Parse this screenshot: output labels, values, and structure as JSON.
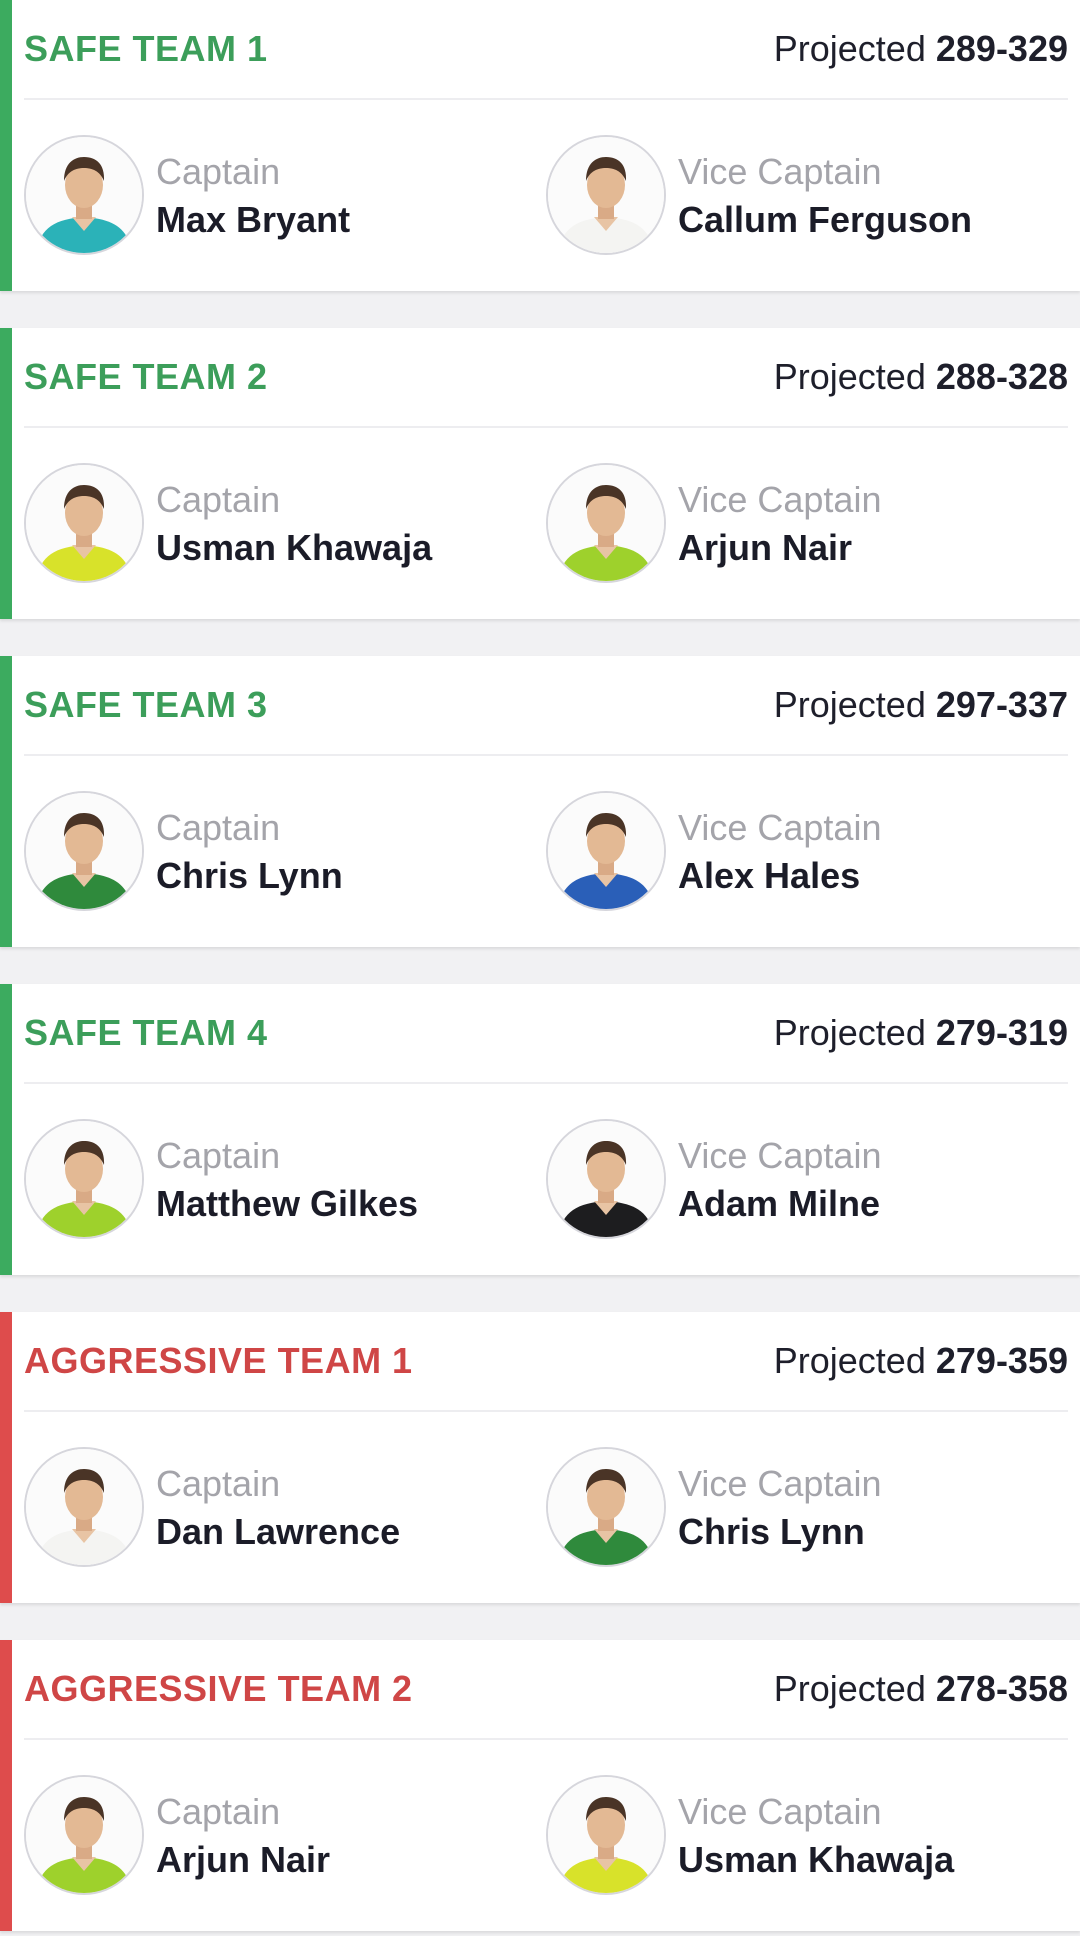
{
  "colors": {
    "safe_accent": "#3cab5f",
    "aggressive_accent": "#de4c4c",
    "jerseys": {
      "teal": "#2bb2b8",
      "white": "#f4f4f2",
      "yellow_green": "#d8e22a",
      "lime": "#9ed12c",
      "red_green": "#2f8a3c",
      "blue": "#2a5fb8",
      "black": "#1d1d1f"
    }
  },
  "teams": [
    {
      "type": "safe",
      "name": "SAFE TEAM 1",
      "projected_label": "Projected",
      "projected_range": "289-329",
      "captain": {
        "role": "Captain",
        "name": "Max Bryant",
        "jersey": "teal"
      },
      "vice_captain": {
        "role": "Vice Captain",
        "name": "Callum Ferguson",
        "jersey": "white"
      }
    },
    {
      "type": "safe",
      "name": "SAFE TEAM 2",
      "projected_label": "Projected",
      "projected_range": "288-328",
      "captain": {
        "role": "Captain",
        "name": "Usman Khawaja",
        "jersey": "yellow_green"
      },
      "vice_captain": {
        "role": "Vice Captain",
        "name": "Arjun Nair",
        "jersey": "lime"
      }
    },
    {
      "type": "safe",
      "name": "SAFE TEAM 3",
      "projected_label": "Projected",
      "projected_range": "297-337",
      "captain": {
        "role": "Captain",
        "name": "Chris Lynn",
        "jersey": "red_green"
      },
      "vice_captain": {
        "role": "Vice Captain",
        "name": "Alex Hales",
        "jersey": "blue"
      }
    },
    {
      "type": "safe",
      "name": "SAFE TEAM 4",
      "projected_label": "Projected",
      "projected_range": "279-319",
      "captain": {
        "role": "Captain",
        "name": "Matthew Gilkes",
        "jersey": "lime"
      },
      "vice_captain": {
        "role": "Vice Captain",
        "name": "Adam Milne",
        "jersey": "black"
      }
    },
    {
      "type": "aggressive",
      "name": "AGGRESSIVE TEAM 1",
      "projected_label": "Projected",
      "projected_range": "279-359",
      "captain": {
        "role": "Captain",
        "name": "Dan Lawrence",
        "jersey": "white"
      },
      "vice_captain": {
        "role": "Vice Captain",
        "name": "Chris Lynn",
        "jersey": "red_green"
      }
    },
    {
      "type": "aggressive",
      "name": "AGGRESSIVE TEAM 2",
      "projected_label": "Projected",
      "projected_range": "278-358",
      "captain": {
        "role": "Captain",
        "name": "Arjun Nair",
        "jersey": "lime"
      },
      "vice_captain": {
        "role": "Vice Captain",
        "name": "Usman Khawaja",
        "jersey": "yellow_green"
      }
    }
  ]
}
